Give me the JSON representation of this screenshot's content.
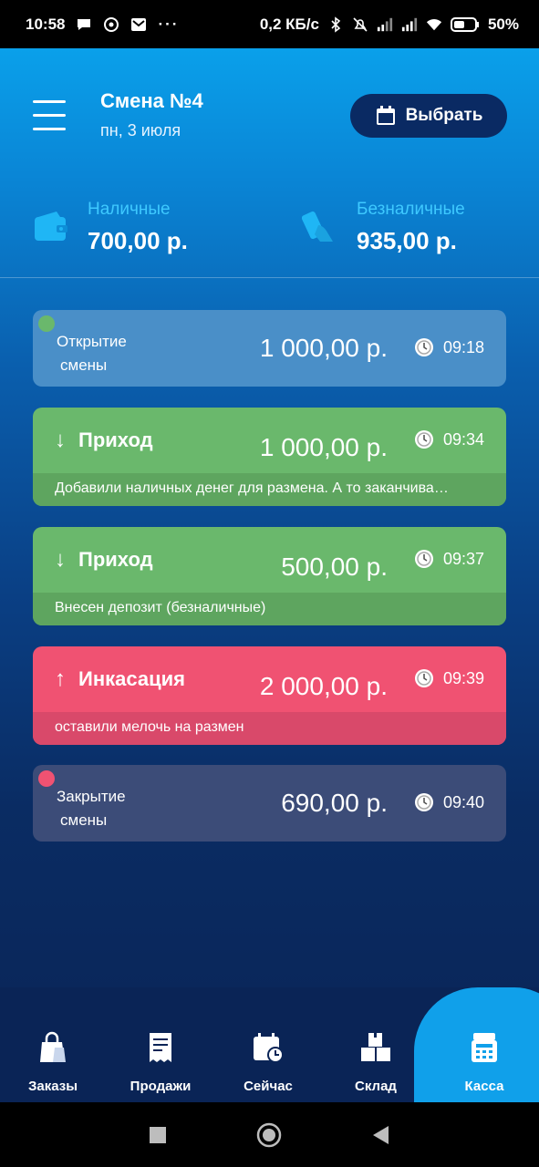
{
  "status_bar": {
    "time": "10:58",
    "dots": "···",
    "speed": "0,2 КБ/с",
    "battery": "50%"
  },
  "header": {
    "title": "Смена №4",
    "date": "пн, 3 июля",
    "select_label": "Выбрать"
  },
  "totals": {
    "cash_label": "Наличные",
    "cash_value": "700,00 р.",
    "card_label": "Безналичные",
    "card_value": "935,00 р."
  },
  "operations": [
    {
      "title_line1": "Открытие",
      "title_line2": "смены",
      "amount": "1 000,00 р.",
      "time": "09:18"
    },
    {
      "title": "Приход",
      "arrow": "↓",
      "amount": "1 000,00 р.",
      "time": "09:34",
      "note": "Добавили наличных денег для размена. А то заканчива…"
    },
    {
      "title": "Приход",
      "arrow": "↓",
      "amount": "500,00 р.",
      "time": "09:37",
      "note": "Внесен депозит (безналичные)"
    },
    {
      "title": "Инкасация",
      "arrow": "↑",
      "amount": "2 000,00 р.",
      "time": "09:39",
      "note": "оставили мелочь на размен"
    },
    {
      "title_line1": "Закрытие",
      "title_line2": "смены",
      "amount": "690,00 р.",
      "time": "09:40"
    }
  ],
  "nav": [
    {
      "label": "Заказы",
      "icon": "bag-icon"
    },
    {
      "label": "Продажи",
      "icon": "receipt-icon"
    },
    {
      "label": "Сейчас",
      "icon": "calendar-clock-icon"
    },
    {
      "label": "Склад",
      "icon": "boxes-icon"
    },
    {
      "label": "Касса",
      "icon": "register-icon",
      "active": true
    }
  ],
  "colors": {
    "income": "#6ab86c",
    "collection": "#f05272",
    "open": "#4a8fc8",
    "close": "#3c4c78",
    "accent": "#10a0ea"
  }
}
